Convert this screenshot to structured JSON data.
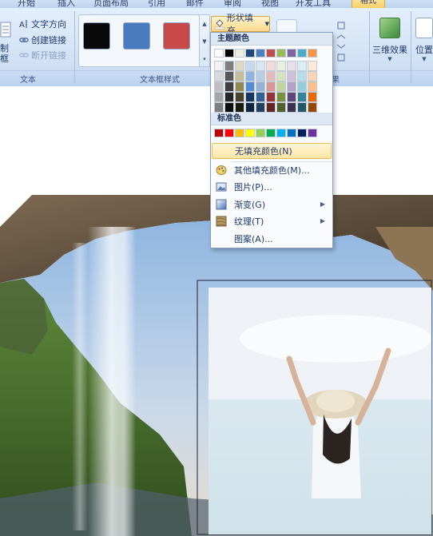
{
  "tabs": [
    {
      "label": "开始"
    },
    {
      "label": "插入"
    },
    {
      "label": "页面布局"
    },
    {
      "label": "引用"
    },
    {
      "label": "邮件"
    },
    {
      "label": "审阅"
    },
    {
      "label": "视图"
    },
    {
      "label": "开发工具"
    },
    {
      "label": "格式",
      "active": true
    }
  ],
  "ribbon": {
    "text_group": {
      "draw_textbox_label": "制框",
      "text_direction": "文字方向",
      "create_link": "创建链接",
      "break_link": "断开链接",
      "label": "文本"
    },
    "textbox_styles": {
      "label": "文本框样式",
      "swatches": [
        "#0a0a0a",
        "#4a7bbf",
        "#c94848"
      ]
    },
    "shape_fill_button": "形状填充",
    "shadow_group_label": "果",
    "effects_3d_label": "三维效果",
    "position_label": "位置"
  },
  "fill_menu": {
    "theme_colors_title": "主题颜色",
    "theme_colors": [
      [
        "#ffffff",
        "#000000",
        "#eeece1",
        "#1f497d",
        "#4f81bd",
        "#c0504d",
        "#9bbb59",
        "#8064a2",
        "#4bacc6",
        "#f79646"
      ],
      [
        "#f2f2f2",
        "#7f7f7f",
        "#ddd9c3",
        "#c6d9f0",
        "#dbe5f1",
        "#f2dcdb",
        "#ebf1dd",
        "#e5e0ec",
        "#dbeef3",
        "#fdeada"
      ],
      [
        "#d8d8d8",
        "#595959",
        "#c4bd97",
        "#8db3e2",
        "#b8cce4",
        "#e5b9b7",
        "#d7e3bc",
        "#ccc1d9",
        "#b7dde8",
        "#fbd5b5"
      ],
      [
        "#bfbfbf",
        "#3f3f3f",
        "#938953",
        "#548dd4",
        "#95b3d7",
        "#d99694",
        "#c3d69b",
        "#b2a2c7",
        "#92cddc",
        "#fac08f"
      ],
      [
        "#a5a5a5",
        "#262626",
        "#494429",
        "#17365d",
        "#366092",
        "#953734",
        "#76923c",
        "#5f497a",
        "#31859b",
        "#e36c09"
      ],
      [
        "#7f7f7f",
        "#0c0c0c",
        "#1d1b10",
        "#0f243e",
        "#244061",
        "#632423",
        "#4f6128",
        "#3f3151",
        "#205867",
        "#974806"
      ]
    ],
    "standard_colors_title": "标准色",
    "standard_colors": [
      "#c00000",
      "#ff0000",
      "#ffc000",
      "#ffff00",
      "#92d050",
      "#00b050",
      "#00b0f0",
      "#0070c0",
      "#002060",
      "#7030a0"
    ],
    "items": [
      {
        "label": "无填充颜色(N)",
        "icon": "no-fill-icon",
        "submenu": false
      },
      {
        "label": "其他填充颜色(M)...",
        "icon": "palette-icon",
        "submenu": false
      },
      {
        "label": "图片(P)...",
        "icon": "picture-icon",
        "submenu": false
      },
      {
        "label": "渐变(G)",
        "icon": "gradient-icon",
        "submenu": true
      },
      {
        "label": "纹理(T)",
        "icon": "texture-icon",
        "submenu": true
      },
      {
        "label": "图案(A)...",
        "icon": "pattern-icon",
        "submenu": false
      }
    ]
  },
  "colors": {
    "ribbon_bg": "#d3e3f6",
    "highlight": "#fde5a4",
    "active_tab": "#f7cf68"
  }
}
